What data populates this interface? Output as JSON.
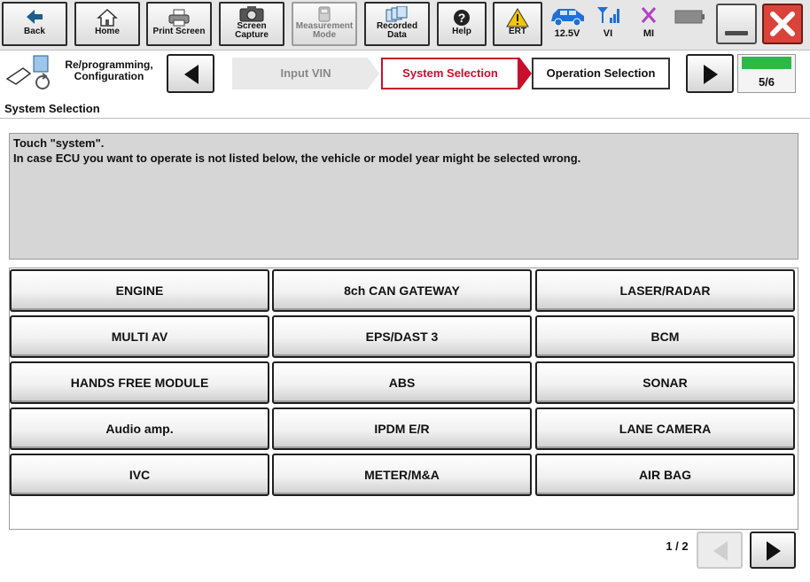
{
  "toolbar": {
    "back": "Back",
    "home": "Home",
    "print_screen": "Print Screen",
    "screen_capture_1": "Screen",
    "screen_capture_2": "Capture",
    "measurement_1": "Measurement",
    "measurement_2": "Mode",
    "recorded_1": "Recorded",
    "recorded_2": "Data",
    "help": "Help",
    "ert": "ERT"
  },
  "status": {
    "battery_voltage": "12.5V",
    "vi": "VI",
    "mi": "MI"
  },
  "breadcrumb": {
    "module_line1": "Re/programming,",
    "module_line2": "Configuration",
    "steps": [
      "Input VIN",
      "System Selection",
      "Operation Selection"
    ],
    "progress": "5/6"
  },
  "section_title": "System Selection",
  "message": {
    "line1": "Touch \"system\".",
    "line2": "In case ECU you want to operate is not listed below, the vehicle or model year might be selected wrong."
  },
  "systems": [
    "ENGINE",
    "8ch CAN GATEWAY",
    "LASER/RADAR",
    "MULTI AV",
    "EPS/DAST 3",
    "BCM",
    "HANDS FREE MODULE",
    "ABS",
    "SONAR",
    "Audio amp.",
    "IPDM E/R",
    "LANE CAMERA",
    "IVC",
    "METER/M&A",
    "AIR BAG"
  ],
  "paging": {
    "page": "1 / 2"
  },
  "colors": {
    "active_step": "#c8102e",
    "progress_fill": "#2fb84a",
    "close_button": "#d9433a",
    "status_icon": "#1f6fd6",
    "mi_icon": "#b040c8",
    "warning": "#f3c400"
  }
}
